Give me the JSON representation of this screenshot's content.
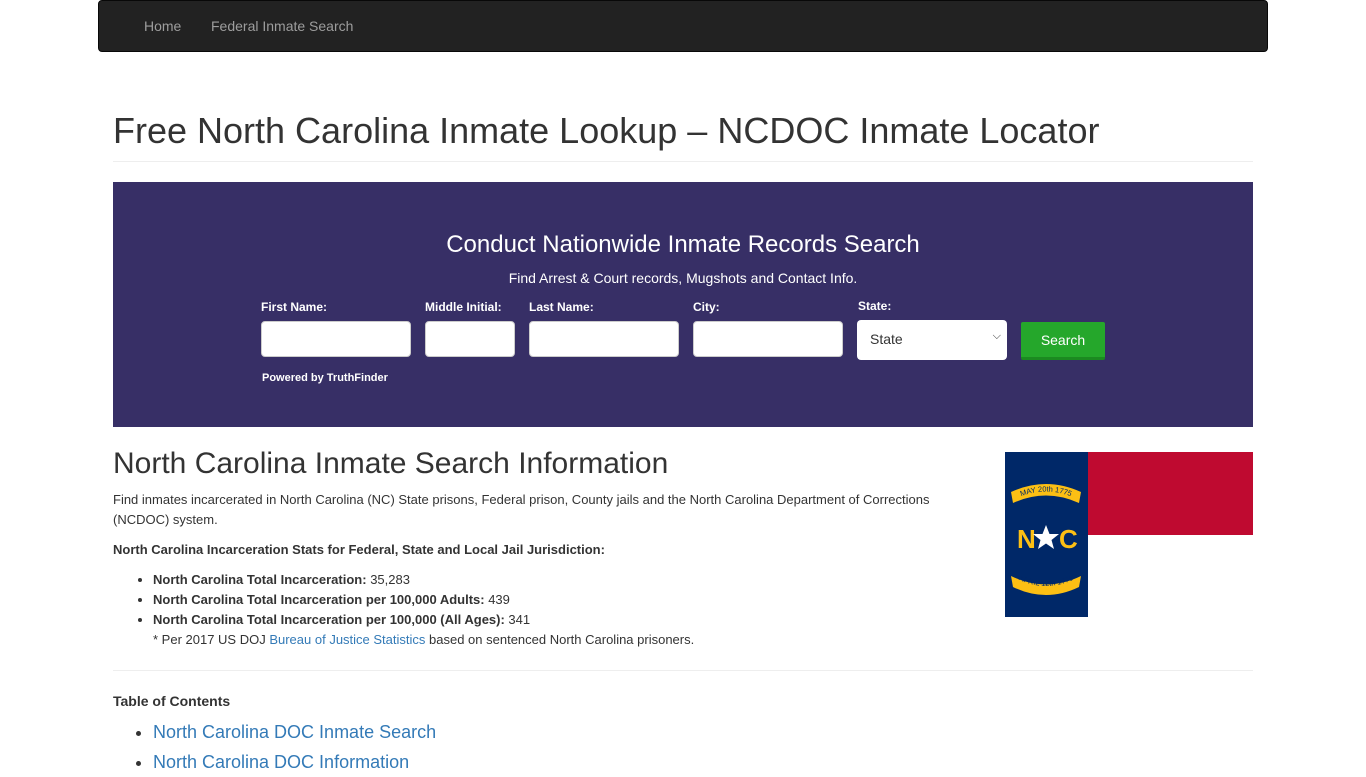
{
  "nav": {
    "items": [
      "Home",
      "Federal Inmate Search"
    ]
  },
  "page_title": "Free North Carolina Inmate Lookup – NCDOC Inmate Locator",
  "search_banner": {
    "title": "Conduct Nationwide Inmate Records Search",
    "subtitle": "Find Arrest & Court records, Mugshots and Contact Info.",
    "labels": {
      "first": "First Name:",
      "middle": "Middle Initial:",
      "last": "Last Name:",
      "city": "City:",
      "state": "State:"
    },
    "state_value": "State",
    "button": "Search",
    "powered": "Powered by TruthFinder",
    "bg_color": "#372f66",
    "button_color": "#25a72b"
  },
  "info": {
    "heading": "North Carolina Inmate Search Information",
    "intro": "Find inmates incarcerated in North Carolina (NC) State prisons, Federal prison, County jails and the North Carolina Department of Corrections (NCDOC) system.",
    "stats_heading": "North Carolina Incarceration Stats for Federal, State and Local Jail Jurisdiction:",
    "stats": [
      {
        "label": "North Carolina Total Incarceration:",
        "value": " 35,283"
      },
      {
        "label": "North Carolina Total Incarceration per 100,000 Adults:",
        "value": " 439"
      },
      {
        "label": "North Carolina Total Incarceration per 100,000 (All Ages):",
        "value": " 341"
      }
    ],
    "note_pre": "* Per 2017 US DOJ ",
    "note_link": "Bureau of Justice Statistics",
    "note_post": " based on sentenced North Carolina prisoners."
  },
  "flag": {
    "top_ribbon": "MAY 20th 1775",
    "bottom_ribbon": "APRIL 12th 1776",
    "letters": "N C"
  },
  "toc": {
    "heading": "Table of Contents",
    "items": [
      "North Carolina DOC Inmate Search",
      "North Carolina DOC Information"
    ]
  }
}
